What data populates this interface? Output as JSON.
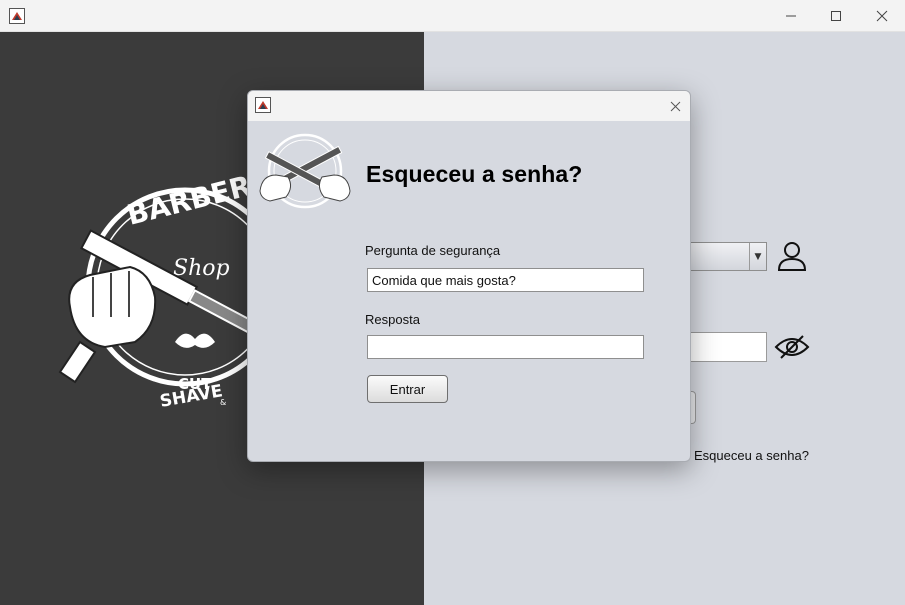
{
  "main_window": {
    "app_icon": "java-app-icon",
    "controls": {
      "minimize": "minimize-icon",
      "maximize": "maximize-icon",
      "close": "close-icon"
    }
  },
  "left_panel": {
    "logo": {
      "top_text": "BARBER",
      "script_text": "Shop",
      "bottom_text_1": "CUT",
      "bottom_text_2": "&",
      "bottom_text_3": "SHAVE"
    }
  },
  "login_form": {
    "user_icon": "user-icon",
    "password_toggle_icon": "eye-slash-icon",
    "forgot_link": "Esqueceu a senha?"
  },
  "dialog": {
    "app_icon": "java-app-icon",
    "close_icon": "close-icon",
    "title": "Esqueceu a senha?",
    "security_question_label": "Pergunta de segurança",
    "security_question_value": "Comida que mais gosta?",
    "answer_label": "Resposta",
    "answer_value": "",
    "submit_label": "Entrar"
  },
  "colors": {
    "dark_panel": "#3b3b3b",
    "light_panel": "#d6d9e0",
    "titlebar": "#f3f3f3"
  }
}
